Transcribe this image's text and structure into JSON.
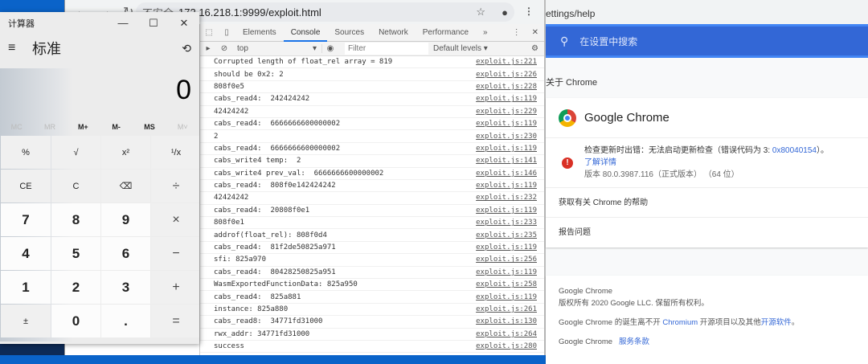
{
  "browser": {
    "url_insecure": "不安全",
    "url": "172.16.218.1:9999/exploit.html"
  },
  "devtools": {
    "tabs": [
      "Elements",
      "Console",
      "Sources",
      "Network",
      "Performance"
    ],
    "more": "»",
    "context": "top",
    "filter_placeholder": "Filter",
    "levels": "Default levels ▾",
    "logs": [
      {
        "msg": "Corrupted length of float_rel array = 819",
        "src": "exploit.js:221"
      },
      {
        "msg": "should be 0x2: 2",
        "src": "exploit.js:226"
      },
      {
        "msg": "808f0e5",
        "src": "exploit.js:228"
      },
      {
        "msg": "cabs_read4:  242424242",
        "src": "exploit.js:119"
      },
      {
        "msg": "42424242",
        "src": "exploit.js:229"
      },
      {
        "msg": "cabs_read4:  6666666600000002",
        "src": "exploit.js:119"
      },
      {
        "msg": "2",
        "src": "exploit.js:230"
      },
      {
        "msg": "cabs_read4:  6666666600000002",
        "src": "exploit.js:119"
      },
      {
        "msg": "cabs_write4 temp:  2",
        "src": "exploit.js:141"
      },
      {
        "msg": "cabs_write4 prev_val:  6666666600000002",
        "src": "exploit.js:146"
      },
      {
        "msg": "cabs_read4:  808f0e142424242",
        "src": "exploit.js:119"
      },
      {
        "msg": "42424242",
        "src": "exploit.js:232"
      },
      {
        "msg": "cabs_read4:  20808f0e1",
        "src": "exploit.js:119"
      },
      {
        "msg": "808f0e1",
        "src": "exploit.js:233"
      },
      {
        "msg": "addrof(float_rel): 808f0d4",
        "src": "exploit.js:235"
      },
      {
        "msg": "cabs_read4:  81f2de50825a971",
        "src": "exploit.js:119"
      },
      {
        "msg": "sfi: 825a970",
        "src": "exploit.js:256"
      },
      {
        "msg": "cabs_read4:  80428250825a951",
        "src": "exploit.js:119"
      },
      {
        "msg": "WasmExportedFunctionData: 825a950",
        "src": "exploit.js:258"
      },
      {
        "msg": "cabs_read4:  825a881",
        "src": "exploit.js:119"
      },
      {
        "msg": "instance: 825a880",
        "src": "exploit.js:261"
      },
      {
        "msg": "cabs_read8:  34771fd31000",
        "src": "exploit.js:130"
      },
      {
        "msg": "rwx_addr: 34771fd31000",
        "src": "exploit.js:264"
      },
      {
        "msg": "success",
        "src": "exploit.js:280"
      }
    ]
  },
  "calculator": {
    "title": "计算器",
    "mode": "标准",
    "display": "0",
    "memory": [
      "MC",
      "MR",
      "M+",
      "M-",
      "MS",
      "M˅"
    ],
    "keys": [
      "%",
      "√",
      "x²",
      "¹/x",
      "CE",
      "C",
      "⌫",
      "÷",
      "7",
      "8",
      "9",
      "×",
      "4",
      "5",
      "6",
      "−",
      "1",
      "2",
      "3",
      "+",
      "±",
      "0",
      ".",
      "="
    ]
  },
  "settings": {
    "url_fragment": "ettings/help",
    "search_placeholder": "在设置中搜索",
    "about": "关于 Chrome",
    "product": "Google Chrome",
    "update_error": "检查更新时出错：无法启动更新检查（错误代码为 3: ",
    "error_code": "0x80040154",
    "update_error_end": "）。",
    "learn_more": "了解详情",
    "version": "版本 80.0.3987.116（正式版本）  （64 位）",
    "help": "获取有关 Chrome 的帮助",
    "report": "报告问题",
    "footer": {
      "name": "Google Chrome",
      "copyright": "版权所有 2020 Google LLC. 保留所有权利。",
      "built_pre": "Google Chrome 的诞生离不开 ",
      "chromium": "Chromium",
      "built_mid": " 开源项目以及其他",
      "oss": "开源软件",
      "built_end": "。",
      "tos_name": "Google Chrome",
      "tos": "服务条款"
    }
  }
}
